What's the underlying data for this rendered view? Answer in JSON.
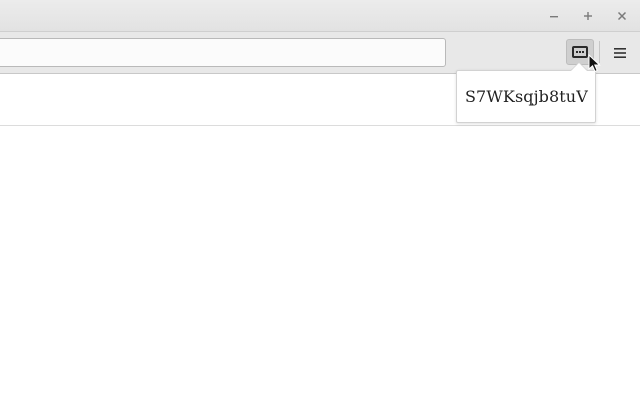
{
  "window": {
    "controls": {
      "minimize_icon": "minimize-icon",
      "maximize_icon": "maximize-icon",
      "close_icon": "close-icon"
    }
  },
  "toolbar": {
    "url_value": "",
    "extension_button_icon": "password-dots-icon",
    "menu_icon": "hamburger-menu-icon"
  },
  "popup": {
    "text": "S7WKsqjb8tuV"
  },
  "colors": {
    "titlebar": "#e6e6e6",
    "toolbar": "#e8e8e8",
    "extension_button_active": "#cfcfcf",
    "icon": "#333333"
  }
}
